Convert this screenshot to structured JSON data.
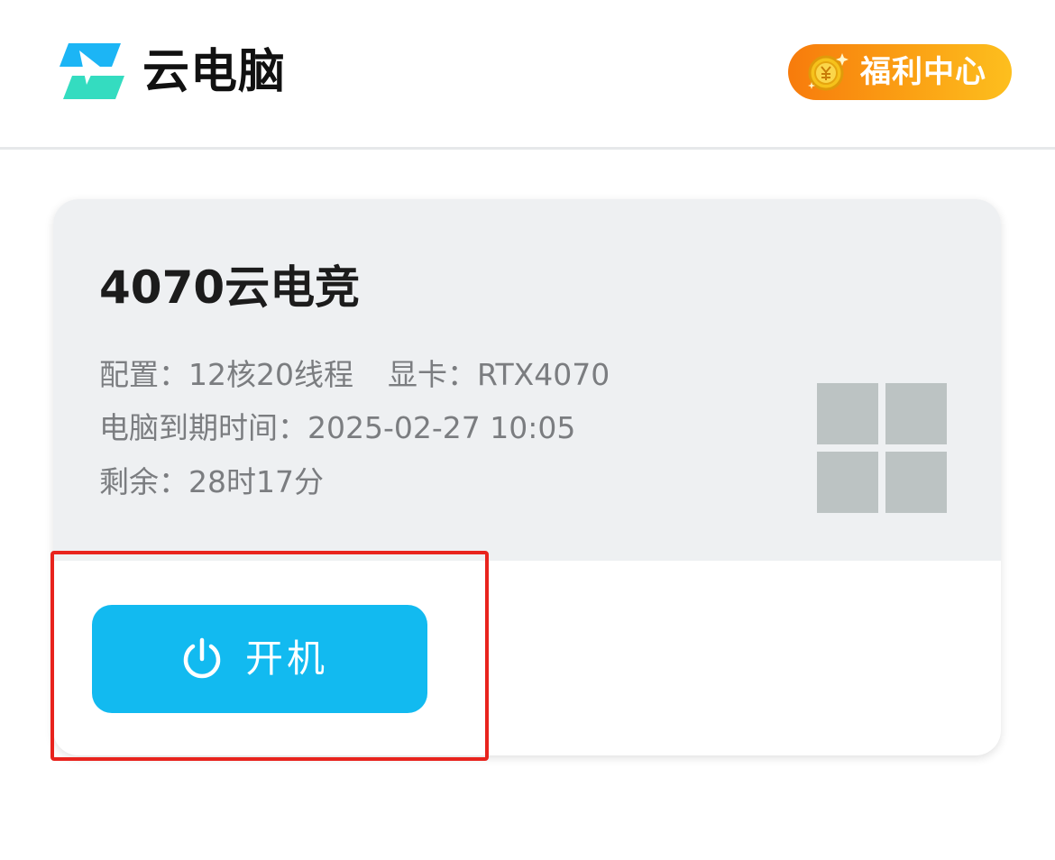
{
  "header": {
    "app_title": "云电脑",
    "logo_icon": "cloud-pc-logo-icon",
    "welfare_label": "福利中心",
    "welfare_icon": "gold-coin-icon",
    "welfare_colors": [
      "#f77b0c",
      "#fdbf1e"
    ]
  },
  "card": {
    "title": "4070云电竞",
    "config_label": "配置：",
    "config_value": "12核20线程",
    "gpu_label": "显卡：",
    "gpu_value": "RTX4070",
    "expiry_label": "电脑到期时间：",
    "expiry_value": "2025-02-27 10:05",
    "remaining_label": "剩余：",
    "remaining_value": "28时17分",
    "os_icon": "windows-icon",
    "power_button_label": "开机",
    "power_icon": "power-icon",
    "power_button_color": "#12baf0"
  },
  "annotation": {
    "highlight_color": "#e8231d"
  }
}
